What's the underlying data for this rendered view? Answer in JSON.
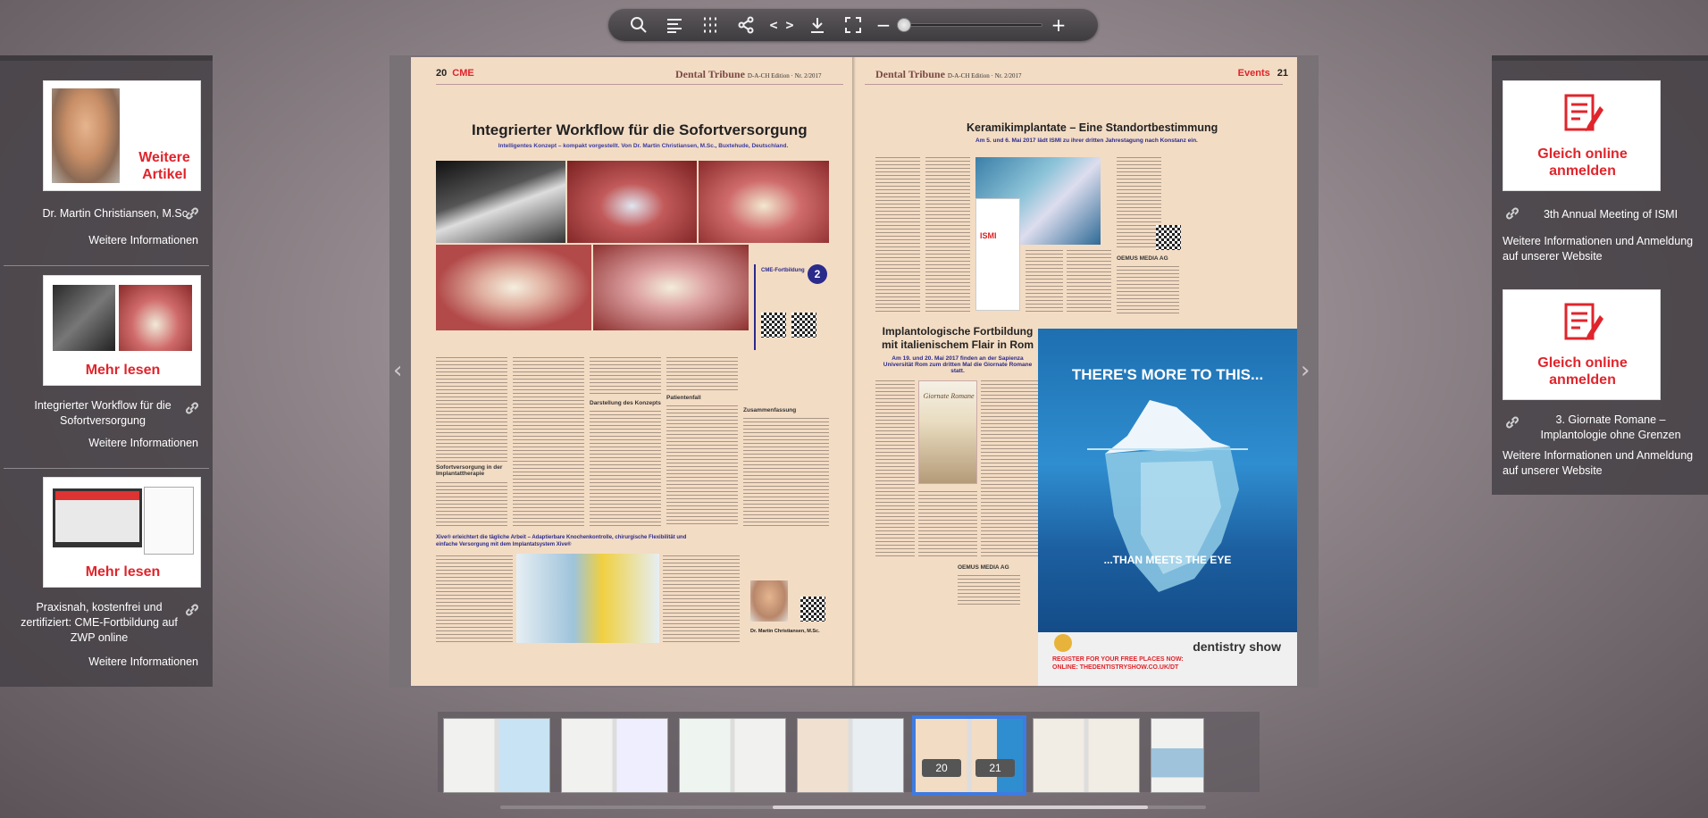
{
  "toolbar": {
    "buttons": [
      "search-icon",
      "toc-icon",
      "grid-icon",
      "share-icon",
      "embed-icon",
      "download-icon",
      "fullscreen-icon"
    ],
    "embed_label": "< >",
    "zoom_minus": "−",
    "zoom_plus": "+",
    "zoom_level": 0.0
  },
  "left_panel": {
    "cards": [
      {
        "label": "Weitere Artikel",
        "title": "Dr. Martin Christiansen, M.Sc",
        "more": "Weitere Informationen"
      },
      {
        "label": "Mehr lesen",
        "title": "Integrierter Workflow für die Sofortversorgung",
        "more": "Weitere Informationen"
      },
      {
        "label": "Mehr lesen",
        "title": "Praxisnah, kostenfrei und zertifiziert: CME-Fortbildung auf ZWP online",
        "more": "Weitere Informationen"
      }
    ]
  },
  "right_panel": {
    "cards": [
      {
        "label": "Gleich online anmelden",
        "title": "3th Annual Meeting of ISMI",
        "more": "Weitere Informationen und Anmeldung auf unserer Website"
      },
      {
        "label": "Gleich online anmelden",
        "title": "3. Giornate Romane – Implantologie ohne Grenzen",
        "more": "Weitere Informationen und Anmeldung auf unserer Website"
      }
    ]
  },
  "magazine": {
    "left_page": {
      "page_number": "20",
      "section": "CME",
      "masthead": "Dental Tribune",
      "edition": "D-A-CH Edition · Nr. 2/2017",
      "headline": "Integrierter Workflow für die Sofortversorgung",
      "subhead": "Intelligentes Konzept – kompakt vorgestellt. Von Dr. Martin Christiansen, M.Sc., Buxtehude, Deutschland.",
      "section_heads": [
        "Sofortversorgung in der Implantattherapie",
        "Darstellung des Konzepts",
        "Patientenfall",
        "Zusammenfassung"
      ],
      "box_title": "Xive® erleichtert die tägliche Arbeit – Adaptierbare Knochenkontrolle, chirurgische Flexibilität und einfache Versorgung mit dem Implantatsystem Xive®",
      "cme_box": "CME-Fortbildung",
      "cme_points": "2",
      "author_caption": "Dr. Martin Christiansen, M.Sc."
    },
    "right_page": {
      "page_number": "21",
      "section": "Events",
      "masthead": "Dental Tribune",
      "edition": "D-A-CH Edition · Nr. 2/2017",
      "headline1": "Keramikimplantate – Eine Standortbestimmung",
      "subhead1": "Am 5. und 6. Mai 2017 lädt ISMI zu ihrer dritten Jahrestagung nach Konstanz ein.",
      "headline2": "Implantologische Fortbildung mit italienischem Flair in Rom",
      "subhead2": "Am 19. und 20. Mai 2017 finden an der Sapienza Universität Rom zum dritten Mal die Giornate Romane statt.",
      "ismi_label": "ISMI",
      "giornate_label": "Giornate Romane",
      "publisher1": "OEMUS MEDIA AG",
      "publisher2": "OEMUS MEDIA AG"
    },
    "ad": {
      "top": "THERE'S MORE TO THIS...",
      "middle": "...THAN MEETS THE EYE",
      "cta": "REGISTER FOR YOUR FREE PLACES NOW: ONLINE: THEDENTISTRYSHOW.CO.UK/DT",
      "brand": "dentistry show"
    },
    "nav_prev": "‹",
    "nav_next": "›"
  },
  "thumbnails": {
    "active_pages": [
      "20",
      "21"
    ]
  }
}
